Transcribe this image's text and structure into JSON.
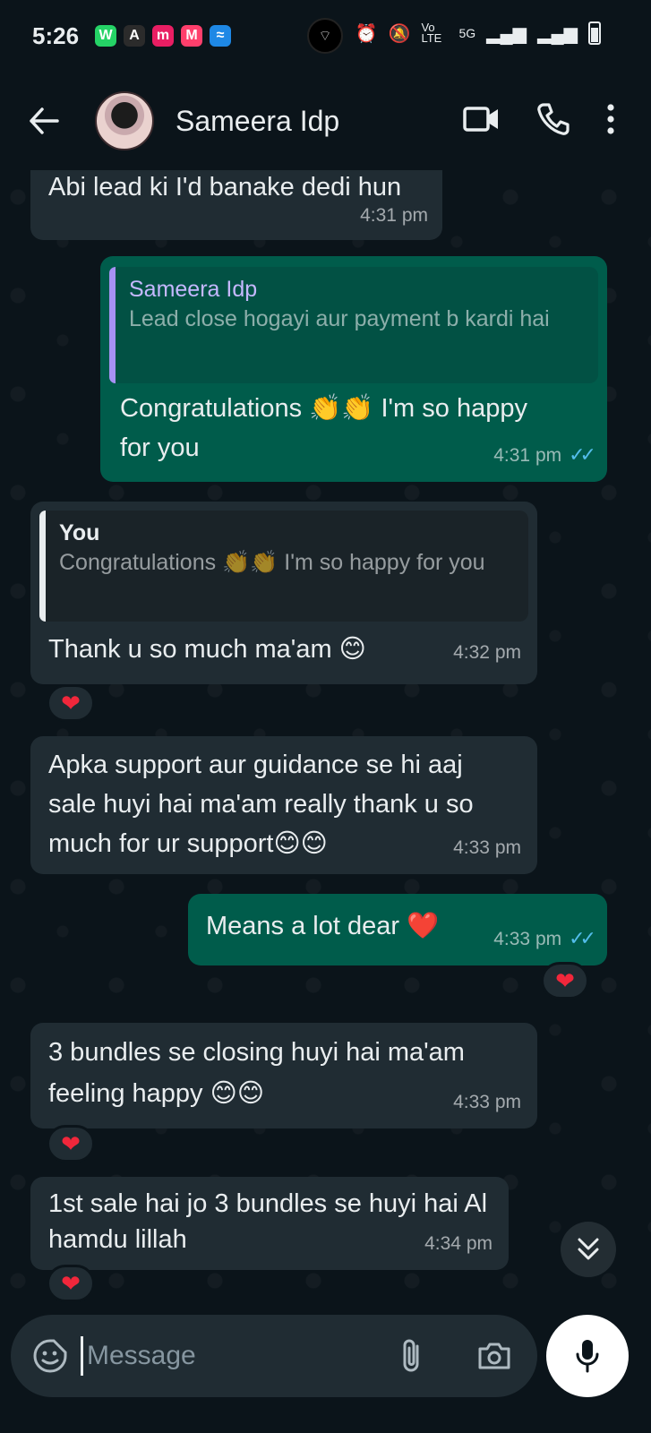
{
  "status": {
    "time": "5:26",
    "network_label": "5G",
    "volte_label": "Vo LTE",
    "apps": [
      {
        "letter": "W",
        "color": "#25d366"
      },
      {
        "letter": "A",
        "color": "#2b2b2b"
      },
      {
        "letter": "m",
        "color": "#e91e63"
      },
      {
        "letter": "M",
        "color": "#ff3f6c"
      },
      {
        "letter": "≈",
        "color": "#1e88e5"
      }
    ]
  },
  "header": {
    "contact_name": "Sameera Idp",
    "icons": [
      "back-arrow-icon",
      "video-call-icon",
      "phone-icon",
      "more-vert-icon"
    ]
  },
  "messages": [
    {
      "id": "m1",
      "dir": "in",
      "text": "Abi lead ki I'd banake dedi hun",
      "time": "4:31 pm"
    },
    {
      "id": "m2",
      "dir": "out",
      "quote": {
        "author": "Sameera Idp",
        "text": "Lead close hogayi aur payment b kardi hai"
      },
      "text": "Congratulations 👏👏 I'm so happy for you",
      "time": "4:31 pm",
      "ticks": "✓✓"
    },
    {
      "id": "m3",
      "dir": "in",
      "quote": {
        "author": "You",
        "text": "Congratulations 👏👏 I'm so happy for you"
      },
      "text": "Thank u so much ma'am 😊",
      "time": "4:32 pm",
      "reaction": "❤"
    },
    {
      "id": "m4",
      "dir": "in",
      "text": "Apka support aur guidance se hi aaj sale huyi hai ma'am really thank u so much for ur support😊😊",
      "time": "4:33 pm"
    },
    {
      "id": "m5",
      "dir": "out",
      "text": "Means a lot dear ❤️",
      "time": "4:33 pm",
      "ticks": "✓✓",
      "reaction": "❤"
    },
    {
      "id": "m6",
      "dir": "in",
      "text": "3 bundles se closing huyi hai ma'am feeling happy 😊😊",
      "time": "4:33 pm",
      "reaction": "❤"
    },
    {
      "id": "m7",
      "dir": "in",
      "text": "1st sale hai jo 3 bundles se huyi hai Al hamdu lillah",
      "time": "4:34 pm",
      "reaction": "❤"
    }
  ],
  "composer": {
    "placeholder": "Message",
    "icons": [
      "sticker-icon",
      "attach-icon",
      "camera-icon",
      "mic-icon"
    ]
  },
  "colors": {
    "background": "#0b141a",
    "incoming_bubble": "#202c33",
    "outgoing_bubble": "#005c4b",
    "read_ticks": "#53bdeb",
    "reaction_heart": "#f1273b"
  }
}
